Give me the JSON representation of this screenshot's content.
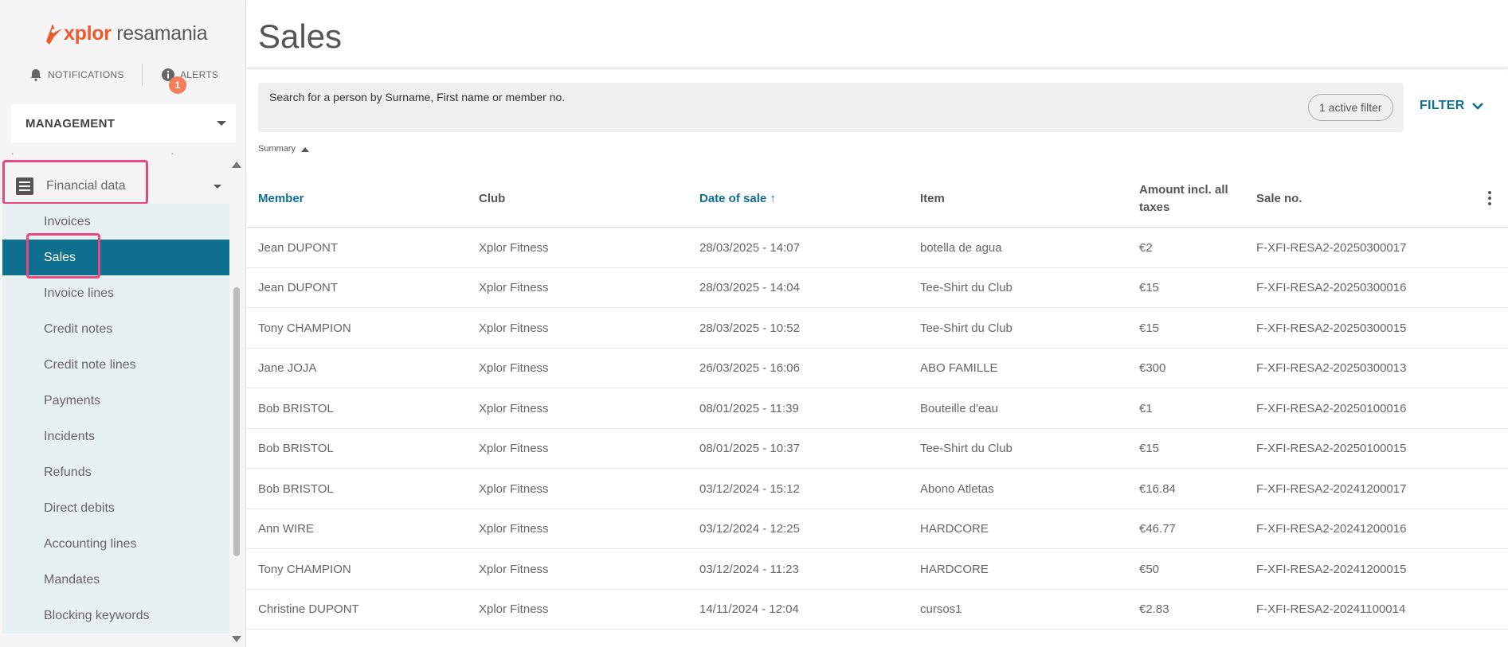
{
  "brand": {
    "xplor": "xplor",
    "resa": " resamania"
  },
  "topnav": {
    "notifications": "NOTIFICATIONS",
    "alerts": "ALERTS",
    "alerts_badge": "1"
  },
  "management": {
    "label": "MANAGEMENT"
  },
  "menu": {
    "section": "Financial data",
    "items": [
      {
        "label": "Invoices"
      },
      {
        "label": "Sales"
      },
      {
        "label": "Invoice lines"
      },
      {
        "label": "Credit notes"
      },
      {
        "label": "Credit note lines"
      },
      {
        "label": "Payments"
      },
      {
        "label": "Incidents"
      },
      {
        "label": "Refunds"
      },
      {
        "label": "Direct debits"
      },
      {
        "label": "Accounting lines"
      },
      {
        "label": "Mandates"
      },
      {
        "label": "Blocking keywords"
      }
    ]
  },
  "page": {
    "title": "Sales"
  },
  "search": {
    "placeholder": "Search for a person by Surname, First name or member no.",
    "chip": "1 active filter"
  },
  "filter": {
    "label": "FILTER"
  },
  "summary": {
    "label": "Summary"
  },
  "table": {
    "headers": {
      "member": "Member",
      "club": "Club",
      "date": "Date of sale ↑",
      "item": "Item",
      "amount": "Amount incl. all taxes",
      "saleno": "Sale no."
    },
    "rows": [
      {
        "member": "Jean DUPONT",
        "club": "Xplor Fitness",
        "date": "28/03/2025 - 14:07",
        "item": "botella de agua",
        "amount": "€2",
        "saleno": "F-XFI-RESA2-20250300017"
      },
      {
        "member": "Jean DUPONT",
        "club": "Xplor Fitness",
        "date": "28/03/2025 - 14:04",
        "item": "Tee-Shirt du Club",
        "amount": "€15",
        "saleno": "F-XFI-RESA2-20250300016"
      },
      {
        "member": "Tony CHAMPION",
        "club": "Xplor Fitness",
        "date": "28/03/2025 - 10:52",
        "item": "Tee-Shirt du Club",
        "amount": "€15",
        "saleno": "F-XFI-RESA2-20250300015"
      },
      {
        "member": "Jane JOJA",
        "club": "Xplor Fitness",
        "date": "26/03/2025 - 16:06",
        "item": "ABO FAMILLE",
        "amount": "€300",
        "saleno": "F-XFI-RESA2-20250300013"
      },
      {
        "member": "Bob BRISTOL",
        "club": "Xplor Fitness",
        "date": "08/01/2025 - 11:39",
        "item": "Bouteille d'eau",
        "amount": "€1",
        "saleno": "F-XFI-RESA2-20250100016"
      },
      {
        "member": "Bob BRISTOL",
        "club": "Xplor Fitness",
        "date": "08/01/2025 - 10:37",
        "item": "Tee-Shirt du Club",
        "amount": "€15",
        "saleno": "F-XFI-RESA2-20250100015"
      },
      {
        "member": "Bob BRISTOL",
        "club": "Xplor Fitness",
        "date": "03/12/2024 - 15:12",
        "item": "Abono Atletas",
        "amount": "€16.84",
        "saleno": "F-XFI-RESA2-20241200017"
      },
      {
        "member": "Ann WIRE",
        "club": "Xplor Fitness",
        "date": "03/12/2024 - 12:25",
        "item": "HARDCORE",
        "amount": "€46.77",
        "saleno": "F-XFI-RESA2-20241200016"
      },
      {
        "member": "Tony CHAMPION",
        "club": "Xplor Fitness",
        "date": "03/12/2024 - 11:23",
        "item": "HARDCORE",
        "amount": "€50",
        "saleno": "F-XFI-RESA2-20241200015"
      },
      {
        "member": "Christine DUPONT",
        "club": "Xplor Fitness",
        "date": "14/11/2024 - 12:04",
        "item": "cursos1",
        "amount": "€2.83",
        "saleno": "F-XFI-RESA2-20241100014"
      }
    ]
  },
  "colors": {
    "accent": "#0f6f8e",
    "brand": "#ee5a2b",
    "highlight": "#e84a7f",
    "badge": "#f47f5b"
  }
}
